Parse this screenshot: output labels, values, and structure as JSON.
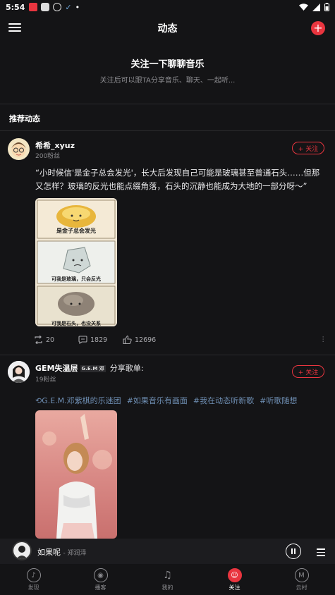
{
  "status_bar": {
    "time": "5:54",
    "dot": "•"
  },
  "header": {
    "title": "动态",
    "add_label": "+"
  },
  "follow_hint": {
    "heading": "关注一下聊聊音乐",
    "subtitle": "关注后可以跟TA分享音乐、聊天、一起听..."
  },
  "section_title": "推荐动态",
  "posts": [
    {
      "author": "希希_xyuz",
      "fans": "200粉丝",
      "follow_label": "+ 关注",
      "text": "“小时候信'是金子总会发光'，长大后发现自己可能是玻璃甚至普通石头……但那又怎样？玻璃的反光也能点缀角落，石头的沉静也能成为大地的一部分呀～”",
      "image_captions": [
        "是金子总会发光",
        "可我是玻璃，只会反光",
        "可我是石头，也没关系"
      ],
      "reposts": "20",
      "comments": "1829",
      "likes": "12696"
    },
    {
      "author": "GEM失温层",
      "badge": "G.E.M 邓",
      "share_text": "分享歌单:",
      "fans": "19粉丝",
      "follow_label": "+ 关注",
      "tags": [
        "G.E.M.邓紫棋的乐迷团",
        "#如果音乐有画面",
        "#我在动态听新歌",
        "#听歌随想"
      ]
    }
  ],
  "player": {
    "song": "如果呢",
    "artist": "- 郑润泽"
  },
  "nav": [
    {
      "label": "发现",
      "icon": "discover-icon"
    },
    {
      "label": "播客",
      "icon": "podcast-icon"
    },
    {
      "label": "我的",
      "icon": "music-note-icon"
    },
    {
      "label": "关注",
      "icon": "follow-icon"
    },
    {
      "label": "云村",
      "icon": "village-icon"
    }
  ],
  "colors": {
    "accent": "#e9353f",
    "background": "#141416",
    "tag": "#6f8fb4"
  }
}
